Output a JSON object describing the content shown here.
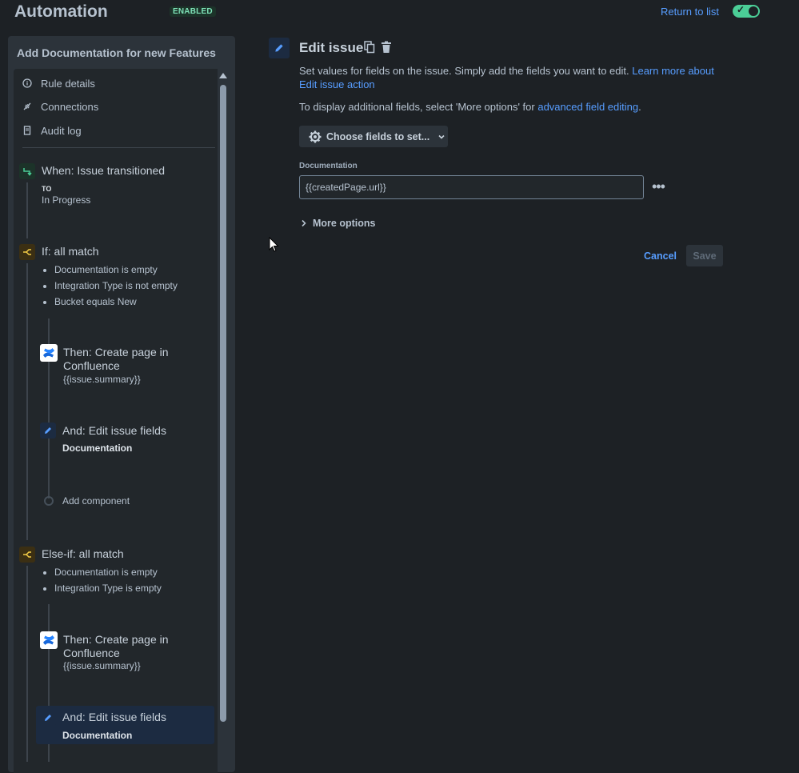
{
  "header": {
    "title": "Automation",
    "status": "ENABLED",
    "return_link": "Return to list"
  },
  "sidebar": {
    "rule_title": "Add Documentation for new Features",
    "menu": [
      {
        "label": "Rule details",
        "icon": "info-icon"
      },
      {
        "label": "Connections",
        "icon": "plug-icon"
      },
      {
        "label": "Audit log",
        "icon": "document-icon"
      }
    ],
    "trigger": {
      "title": "When: Issue transitioned",
      "to_label": "TO",
      "to_value": "In Progress"
    },
    "if_block": {
      "title": "If: all match",
      "conditions": [
        "Documentation is empty",
        "Integration Type is not empty",
        "Bucket equals New"
      ],
      "create_page": {
        "title_line1": "Then: Create page in",
        "title_line2": "Confluence",
        "subtitle": "{{issue.summary}}"
      },
      "edit_fields": {
        "title": "And: Edit issue fields",
        "field": "Documentation"
      },
      "add_component": "Add component"
    },
    "else_if_block": {
      "title": "Else-if: all match",
      "conditions": [
        "Documentation is empty",
        "Integration Type is empty"
      ],
      "create_page": {
        "title_line1": "Then: Create page in",
        "title_line2": "Confluence",
        "subtitle": "{{issue.summary}}"
      },
      "edit_fields": {
        "title": "And: Edit issue fields",
        "field": "Documentation"
      }
    }
  },
  "main": {
    "title": "Edit issue",
    "description_text": "Set values for fields on the issue. Simply add the fields you want to edit. ",
    "description_link": "Learn more about Edit issue action",
    "additional_text": "To display additional fields, select 'More options' for ",
    "additional_link": "advanced field editing",
    "additional_suffix": ".",
    "choose_fields_button": "Choose fields to set...",
    "field_label": "Documentation",
    "field_value": "{{createdPage.url}}",
    "more_options": "More options",
    "cancel": "Cancel",
    "save": "Save"
  },
  "colors": {
    "background": "#1d2125",
    "accent": "#579dff",
    "enabled_green": "#4bce97",
    "condition_yellow": "#f5cd47"
  }
}
